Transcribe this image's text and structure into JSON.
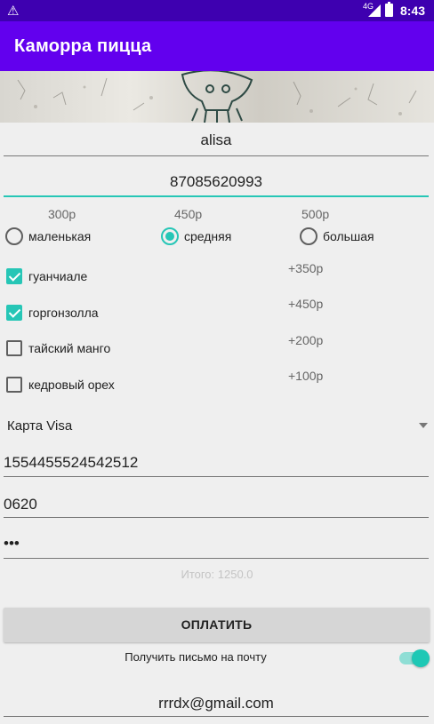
{
  "status": {
    "network": "4G",
    "time": "8:43"
  },
  "app": {
    "title": "Каморра пицца"
  },
  "form": {
    "name": "alisa",
    "phone": "87085620993",
    "sizes": [
      {
        "price": "300р",
        "label": "маленькая",
        "selected": false
      },
      {
        "price": "450р",
        "label": "средняя",
        "selected": true
      },
      {
        "price": "500р",
        "label": "большая",
        "selected": false
      }
    ],
    "toppings": [
      {
        "label": "гуанчиале",
        "extra": "+350р",
        "checked": true
      },
      {
        "label": "горгонзолла",
        "extra": "+450р",
        "checked": true
      },
      {
        "label": "тайский манго",
        "extra": "+200р",
        "checked": false
      },
      {
        "label": "кедровый орех",
        "extra": "+100р",
        "checked": false
      }
    ],
    "payment_method": "Карта Visa",
    "card_number": "1554455524542512",
    "expiry": "0620",
    "cvv": "•••",
    "total": "Итого: 1250.0",
    "pay_button": "ОПЛАТИТЬ",
    "email_switch_label": "Получить письмо на почту",
    "email_switch_on": true,
    "email": "rrrdx@gmail.com"
  },
  "colors": {
    "primary": "#6200ee",
    "status_bar": "#3e00b0",
    "accent": "#26c6b6"
  }
}
